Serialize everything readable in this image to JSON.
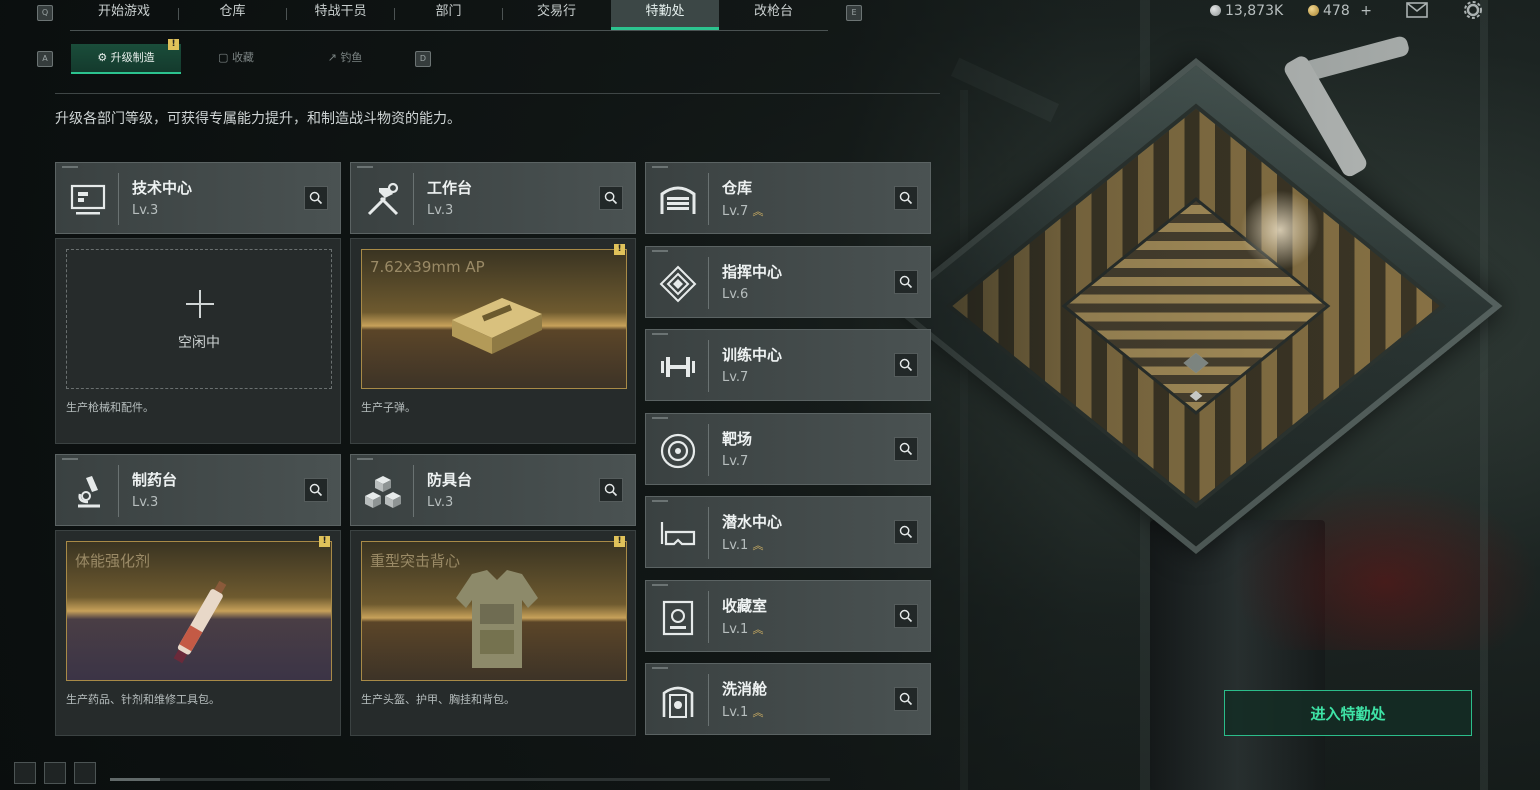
{
  "top_nav": {
    "key_left": "Q",
    "key_right": "E",
    "tabs": [
      {
        "label": "开始游戏",
        "active": false
      },
      {
        "label": "仓库",
        "active": false
      },
      {
        "label": "特战干员",
        "active": false
      },
      {
        "label": "部门",
        "active": false
      },
      {
        "label": "交易行",
        "active": false
      },
      {
        "label": "特勤处",
        "active": true
      },
      {
        "label": "改枪台",
        "active": false
      }
    ],
    "currency_silver": "13,873K",
    "currency_gold": "478",
    "currency_plus": "+"
  },
  "sub_tabs": {
    "key_left": "A",
    "key_right": "D",
    "items": [
      {
        "label": "升级制造",
        "active": true,
        "alert": "!"
      },
      {
        "label": "收藏",
        "active": false
      },
      {
        "label": "钓鱼",
        "active": false
      }
    ]
  },
  "description": "升级各部门等级，可获得专属能力提升，和制造战斗物资的能力。",
  "production_cards": [
    {
      "name": "技术中心",
      "level": "Lv.3",
      "icon": "computer-icon",
      "state": "idle",
      "idle_label": "空闲中",
      "desc": "生产枪械和配件。"
    },
    {
      "name": "工作台",
      "level": "Lv.3",
      "icon": "tools-icon",
      "state": "producing",
      "item": "7.62x39mm AP",
      "alert": "!",
      "desc": "生产子弹。"
    },
    {
      "name": "制药台",
      "level": "Lv.3",
      "icon": "microscope-icon",
      "state": "producing",
      "item": "体能强化剂",
      "alert": "!",
      "desc": "生产药品、针剂和维修工具包。"
    },
    {
      "name": "防具台",
      "level": "Lv.3",
      "icon": "blocks-icon",
      "state": "producing",
      "item": "重型突击背心",
      "alert": "!",
      "desc": "生产头盔、护甲、胸挂和背包。"
    }
  ],
  "facilities": [
    {
      "name": "仓库",
      "level": "Lv.7",
      "upgrade": true,
      "icon": "storage-icon"
    },
    {
      "name": "指挥中心",
      "level": "Lv.6",
      "upgrade": false,
      "icon": "command-icon"
    },
    {
      "name": "训练中心",
      "level": "Lv.7",
      "upgrade": false,
      "icon": "dumbbell-icon"
    },
    {
      "name": "靶场",
      "level": "Lv.7",
      "upgrade": false,
      "icon": "target-icon"
    },
    {
      "name": "潜水中心",
      "level": "Lv.1",
      "upgrade": true,
      "icon": "goggles-icon"
    },
    {
      "name": "收藏室",
      "level": "Lv.1",
      "upgrade": true,
      "icon": "collection-icon"
    },
    {
      "name": "洗消舱",
      "level": "Lv.1",
      "upgrade": true,
      "icon": "decon-icon"
    }
  ],
  "enter_button": "进入特勤处",
  "colors": {
    "accent": "#2cc38f",
    "alert": "#e0c25a",
    "upgrade": "#d8b765"
  }
}
